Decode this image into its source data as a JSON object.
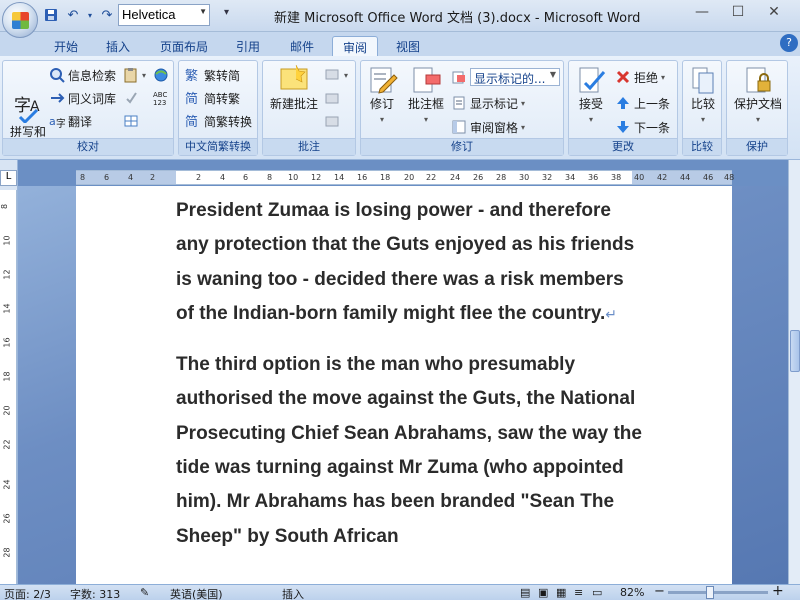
{
  "titlebar": {
    "font_box": "Helvetica",
    "title": "新建 Microsoft Office Word 文档 (3).docx - Microsoft Word"
  },
  "tabs": [
    "开始",
    "插入",
    "页面布局",
    "引用",
    "邮件",
    "审阅",
    "视图"
  ],
  "active_tab": "审阅",
  "ribbon": {
    "proofing": {
      "label": "校对",
      "spelling": "拼写和\n语法",
      "research": "信息检索",
      "thesaurus": "同义词库",
      "translate": "翻译"
    },
    "chinese": {
      "label": "中文简繁转换",
      "to_traditional": "繁转简",
      "to_simplified": "简转繁",
      "convert": "简繁转换"
    },
    "comments": {
      "label": "批注",
      "new_comment": "新建批注"
    },
    "tracking": {
      "label": "修订",
      "track_changes": "修订",
      "balloons": "批注框",
      "display_markup": "显示标记的...",
      "show_markup": "显示标记",
      "review_pane": "审阅窗格"
    },
    "changes": {
      "label": "更改",
      "accept": "接受",
      "reject": "拒绝",
      "previous": "上一条",
      "next": "下一条"
    },
    "compare": {
      "label": "比较",
      "compare": "比较"
    },
    "protect": {
      "label": "保护",
      "protect_doc": "保护文档"
    }
  },
  "ruler_h": [
    "8",
    "6",
    "4",
    "2",
    "2",
    "4",
    "6",
    "8",
    "10",
    "12",
    "14",
    "16",
    "18",
    "20",
    "22",
    "24",
    "26",
    "28",
    "30",
    "32",
    "34",
    "36",
    "38",
    "40",
    "42",
    "44",
    "46",
    "48"
  ],
  "ruler_v": [
    "8",
    "10",
    "12",
    "14",
    "16",
    "18",
    "20",
    "22",
    "24",
    "26",
    "28"
  ],
  "document": {
    "paragraphs": [
      "President Zumaa is losing power - and therefore any protection that the Guts enjoyed as his friends is waning too - decided there was a risk members of the Indian-born family might flee the country.",
      "The third option is the man who presumably authorised the move against the Guts, the National Prosecuting Chief Sean Abrahams, saw the way the tide was turning against Mr Zuma (who appointed him). Mr Abrahams has been branded \"Sean The Sheep\" by South African"
    ]
  },
  "statusbar": {
    "page": "页面: 2/3",
    "words": "字数: 313",
    "language": "英语(美国)",
    "mode": "插入",
    "zoom": "82%",
    "zoom_minus": "−",
    "zoom_plus": "+"
  },
  "colors": {
    "ribbon_text": "#15428b",
    "doc_background": "#6d8ec3"
  }
}
